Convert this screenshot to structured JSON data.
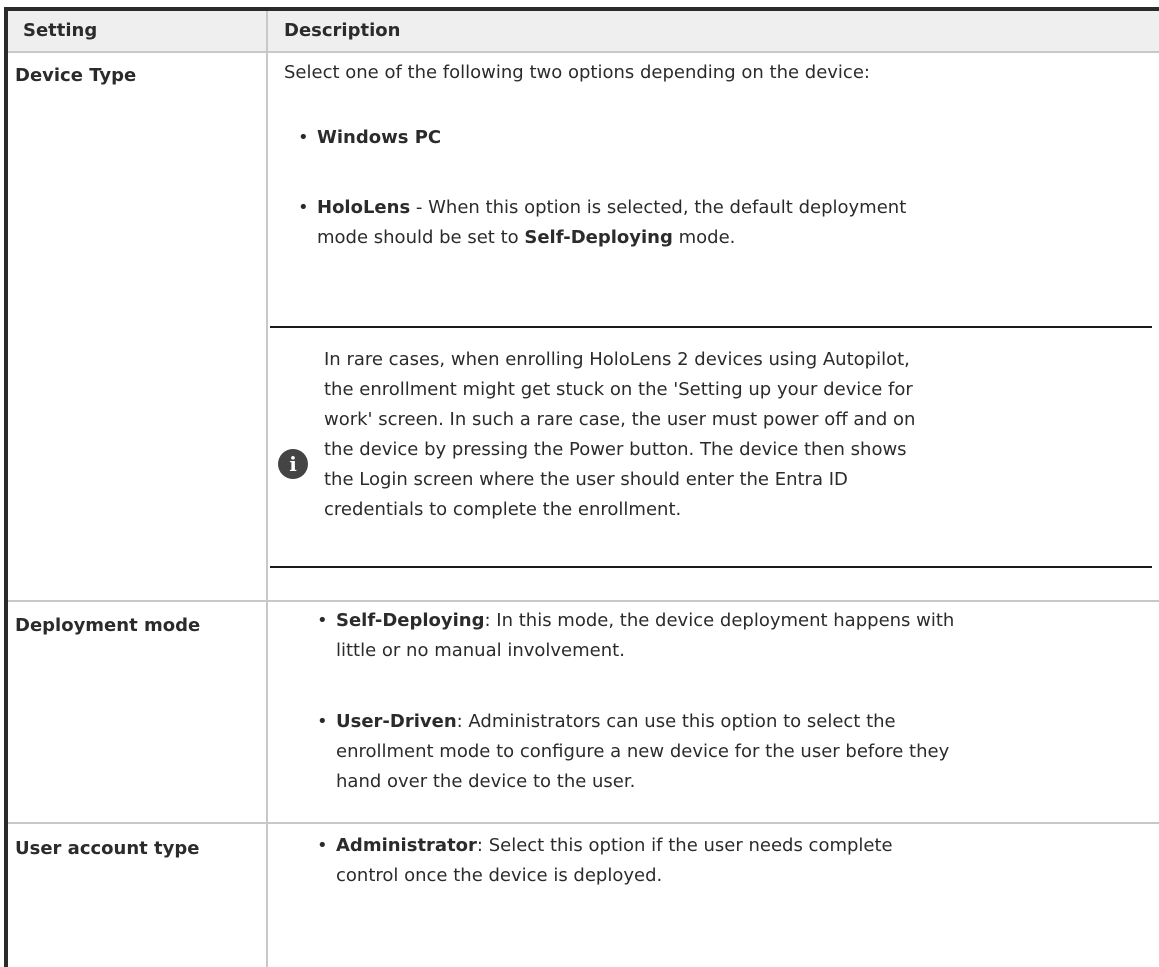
{
  "table": {
    "headers": [
      "Setting",
      "Description"
    ],
    "rows": {
      "device_type": {
        "setting": "Device Type",
        "intro": "Select one of the following two options depending on the device:",
        "option1": {
          "name": "Windows PC"
        },
        "option2": {
          "name": "HoloLens",
          "text_a": " - When this option is selected, the default deployment",
          "text_b": "mode should be set to ",
          "bold_b": "Self-Deploying",
          "text_c": " mode."
        },
        "note_lines": [
          "In rare cases, when enrolling HoloLens 2 devices using Autopilot,",
          "the enrollment might get stuck on the 'Setting up your device for",
          "work' screen. In such a rare case, the user must power off and on",
          "the device by pressing the Power button. The device then shows",
          "the Login screen where the user should enter the Entra ID",
          "credentials to complete the enrollment."
        ]
      },
      "deployment_mode": {
        "setting": "Deployment mode",
        "opt1": {
          "name": "Self-Deploying",
          "line1": ": In this mode, the device deployment happens with",
          "line2": "little or no manual involvement."
        },
        "opt2": {
          "name": "User-Driven",
          "line1": ": Administrators can use this option to select the",
          "line2": "enrollment mode to configure a new device for the user before they",
          "line3": "hand over the device to the user."
        }
      },
      "user_account_type": {
        "setting": "User account type",
        "opt1": {
          "name": "Administrator",
          "line1": ": Select this option if the user needs complete",
          "line2": "control once the device is deployed."
        }
      }
    }
  },
  "icons": {
    "note": "info-icon"
  },
  "colors": {
    "header_bg": "#efefef",
    "border": "#c8c8c8",
    "frame": "#2b2b2b",
    "icon_bg": "#444444"
  }
}
